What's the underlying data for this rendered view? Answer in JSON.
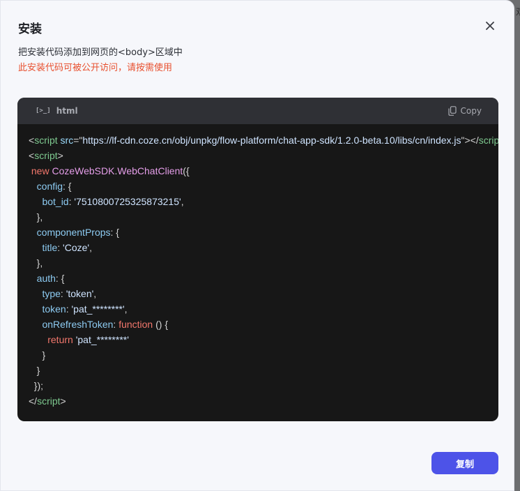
{
  "edge_text": "双",
  "modal": {
    "title": "安装",
    "description": "把安装代码添加到网页的<body>区域中",
    "warning": "此安装代码可被公开访问，请按需使用",
    "close_icon": "close-icon"
  },
  "code_panel": {
    "language": "html",
    "language_icon": "[>_]",
    "copy_label": "Copy",
    "lines": [
      [
        {
          "t": "<",
          "c": "punc"
        },
        {
          "t": "script",
          "c": "tag"
        },
        {
          "t": " ",
          "c": "plain"
        },
        {
          "t": "src",
          "c": "attr"
        },
        {
          "t": "=\"",
          "c": "punc"
        },
        {
          "t": "https://lf-cdn.coze.cn/obj/unpkg/flow-platform/chat-app-sdk/1.2.0-beta.10/libs/cn/index.js",
          "c": "str"
        },
        {
          "t": "\"></",
          "c": "punc"
        },
        {
          "t": "script",
          "c": "tag"
        },
        {
          "t": ">",
          "c": "punc"
        }
      ],
      [
        {
          "t": "<",
          "c": "punc"
        },
        {
          "t": "script",
          "c": "tag"
        },
        {
          "t": ">",
          "c": "punc"
        }
      ],
      [
        {
          "t": " ",
          "c": "plain"
        },
        {
          "t": "new",
          "c": "key"
        },
        {
          "t": " ",
          "c": "plain"
        },
        {
          "t": "CozeWebSDK",
          "c": "cls"
        },
        {
          "t": ".",
          "c": "punc"
        },
        {
          "t": "WebChatClient",
          "c": "cls"
        },
        {
          "t": "({",
          "c": "punc"
        }
      ],
      [
        {
          "t": "   ",
          "c": "plain"
        },
        {
          "t": "config",
          "c": "prop"
        },
        {
          "t": ": {",
          "c": "punc"
        }
      ],
      [
        {
          "t": "     ",
          "c": "plain"
        },
        {
          "t": "bot_id",
          "c": "prop"
        },
        {
          "t": ": ",
          "c": "punc"
        },
        {
          "t": "'7510800725325873215'",
          "c": "str"
        },
        {
          "t": ",",
          "c": "punc"
        }
      ],
      [
        {
          "t": "   },",
          "c": "punc"
        }
      ],
      [
        {
          "t": "   ",
          "c": "plain"
        },
        {
          "t": "componentProps",
          "c": "prop"
        },
        {
          "t": ": {",
          "c": "punc"
        }
      ],
      [
        {
          "t": "     ",
          "c": "plain"
        },
        {
          "t": "title",
          "c": "prop"
        },
        {
          "t": ": ",
          "c": "punc"
        },
        {
          "t": "'Coze'",
          "c": "str"
        },
        {
          "t": ",",
          "c": "punc"
        }
      ],
      [
        {
          "t": "   },",
          "c": "punc"
        }
      ],
      [
        {
          "t": "   ",
          "c": "plain"
        },
        {
          "t": "auth",
          "c": "prop"
        },
        {
          "t": ": {",
          "c": "punc"
        }
      ],
      [
        {
          "t": "     ",
          "c": "plain"
        },
        {
          "t": "type",
          "c": "prop"
        },
        {
          "t": ": ",
          "c": "punc"
        },
        {
          "t": "'token'",
          "c": "str"
        },
        {
          "t": ",",
          "c": "punc"
        }
      ],
      [
        {
          "t": "     ",
          "c": "plain"
        },
        {
          "t": "token",
          "c": "prop"
        },
        {
          "t": ": ",
          "c": "punc"
        },
        {
          "t": "'pat_********'",
          "c": "str"
        },
        {
          "t": ",",
          "c": "punc"
        }
      ],
      [
        {
          "t": "     ",
          "c": "plain"
        },
        {
          "t": "onRefreshToken",
          "c": "prop"
        },
        {
          "t": ": ",
          "c": "punc"
        },
        {
          "t": "function",
          "c": "key"
        },
        {
          "t": " () {",
          "c": "punc"
        }
      ],
      [
        {
          "t": "       ",
          "c": "plain"
        },
        {
          "t": "return",
          "c": "key"
        },
        {
          "t": " ",
          "c": "plain"
        },
        {
          "t": "'pat_********'",
          "c": "str"
        }
      ],
      [
        {
          "t": "     }",
          "c": "punc"
        }
      ],
      [
        {
          "t": "   }",
          "c": "punc"
        }
      ],
      [
        {
          "t": "  });",
          "c": "punc"
        }
      ],
      [
        {
          "t": "</",
          "c": "punc"
        },
        {
          "t": "script",
          "c": "tag"
        },
        {
          "t": ">",
          "c": "punc"
        }
      ]
    ]
  },
  "footer": {
    "copy_button": "复制"
  },
  "colors": {
    "accent": "#4d53e8",
    "warning": "#e8502f",
    "code_bg": "#171717"
  }
}
